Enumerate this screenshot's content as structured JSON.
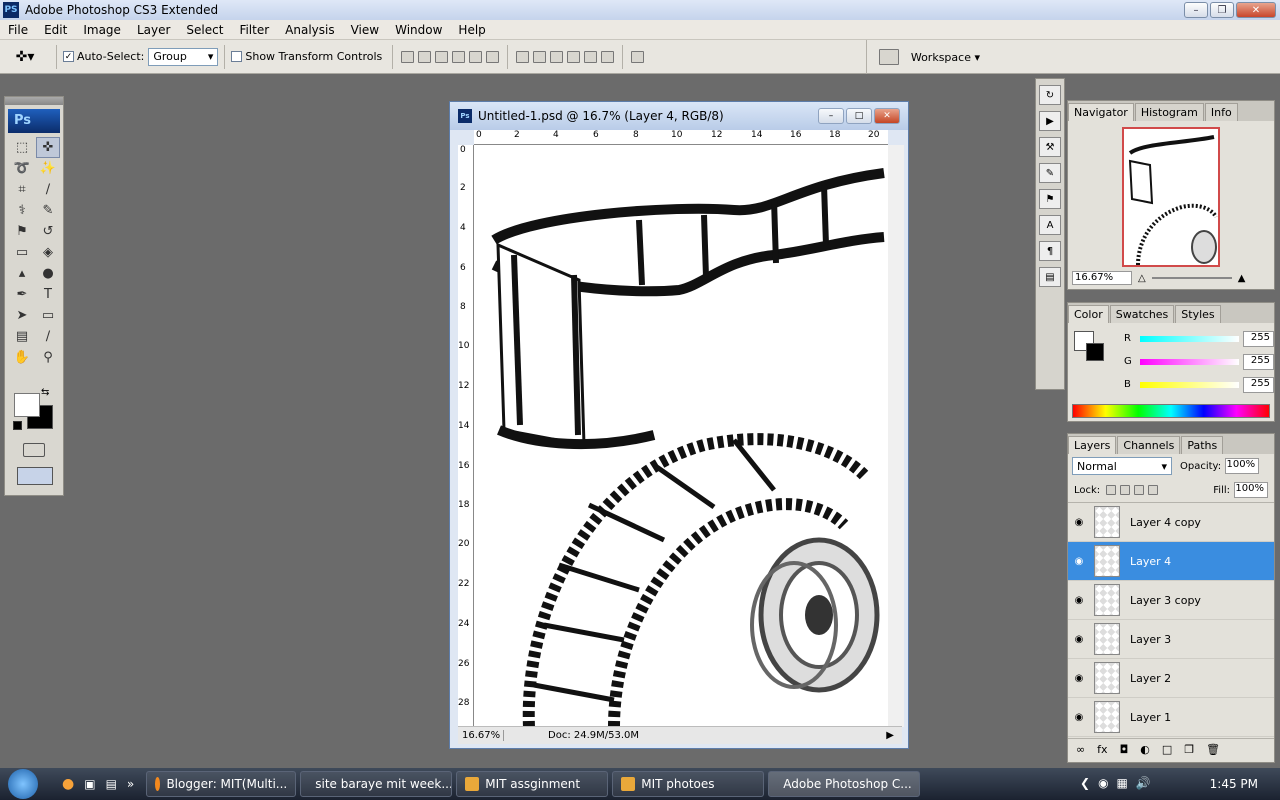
{
  "window": {
    "app_icon": "PS",
    "title": "Adobe Photoshop CS3 Extended"
  },
  "menu": [
    "File",
    "Edit",
    "Image",
    "Layer",
    "Select",
    "Filter",
    "Analysis",
    "View",
    "Window",
    "Help"
  ],
  "options": {
    "auto_select_label": "Auto-Select:",
    "auto_select_checked": true,
    "auto_select_value": "Group",
    "show_transform_label": "Show Transform Controls",
    "show_transform_checked": false,
    "workspace_label": "Workspace"
  },
  "toolbox": {
    "logo": "Ps"
  },
  "document": {
    "title": "Untitled-1.psd @ 16.7% (Layer 4, RGB/8)",
    "ruler_h": [
      "0",
      "2",
      "4",
      "6",
      "8",
      "10",
      "12",
      "14",
      "16",
      "18",
      "20"
    ],
    "ruler_v": [
      "0",
      "2",
      "4",
      "6",
      "8",
      "10",
      "12",
      "14",
      "16",
      "18",
      "20",
      "22",
      "24",
      "26",
      "28"
    ],
    "zoom": "16.67%",
    "doc_info": "Doc: 24.9M/53.0M"
  },
  "navigator": {
    "tabs": [
      "Navigator",
      "Histogram",
      "Info"
    ],
    "zoom": "16.67%"
  },
  "color": {
    "tabs": [
      "Color",
      "Swatches",
      "Styles"
    ],
    "r_label": "R",
    "r_value": "255",
    "g_label": "G",
    "g_value": "255",
    "b_label": "B",
    "b_value": "255"
  },
  "layers": {
    "tabs": [
      "Layers",
      "Channels",
      "Paths"
    ],
    "blend_mode": "Normal",
    "opacity_label": "Opacity:",
    "opacity_value": "100%",
    "lock_label": "Lock:",
    "fill_label": "Fill:",
    "fill_value": "100%",
    "items": [
      {
        "name": "Layer 4 copy",
        "selected": false
      },
      {
        "name": "Layer 4",
        "selected": true
      },
      {
        "name": "Layer 3 copy",
        "selected": false
      },
      {
        "name": "Layer 3",
        "selected": false
      },
      {
        "name": "Layer 2",
        "selected": false
      },
      {
        "name": "Layer 1",
        "selected": false
      }
    ]
  },
  "taskbar": {
    "items": [
      {
        "label": "Blogger: MIT(Multi...",
        "active": false
      },
      {
        "label": "site baraye mit week...",
        "active": false
      },
      {
        "label": "MIT  assginment",
        "active": false
      },
      {
        "label": "MIT photoes",
        "active": false
      },
      {
        "label": "Adobe Photoshop C...",
        "active": true
      }
    ],
    "clock": "1:45 PM"
  }
}
